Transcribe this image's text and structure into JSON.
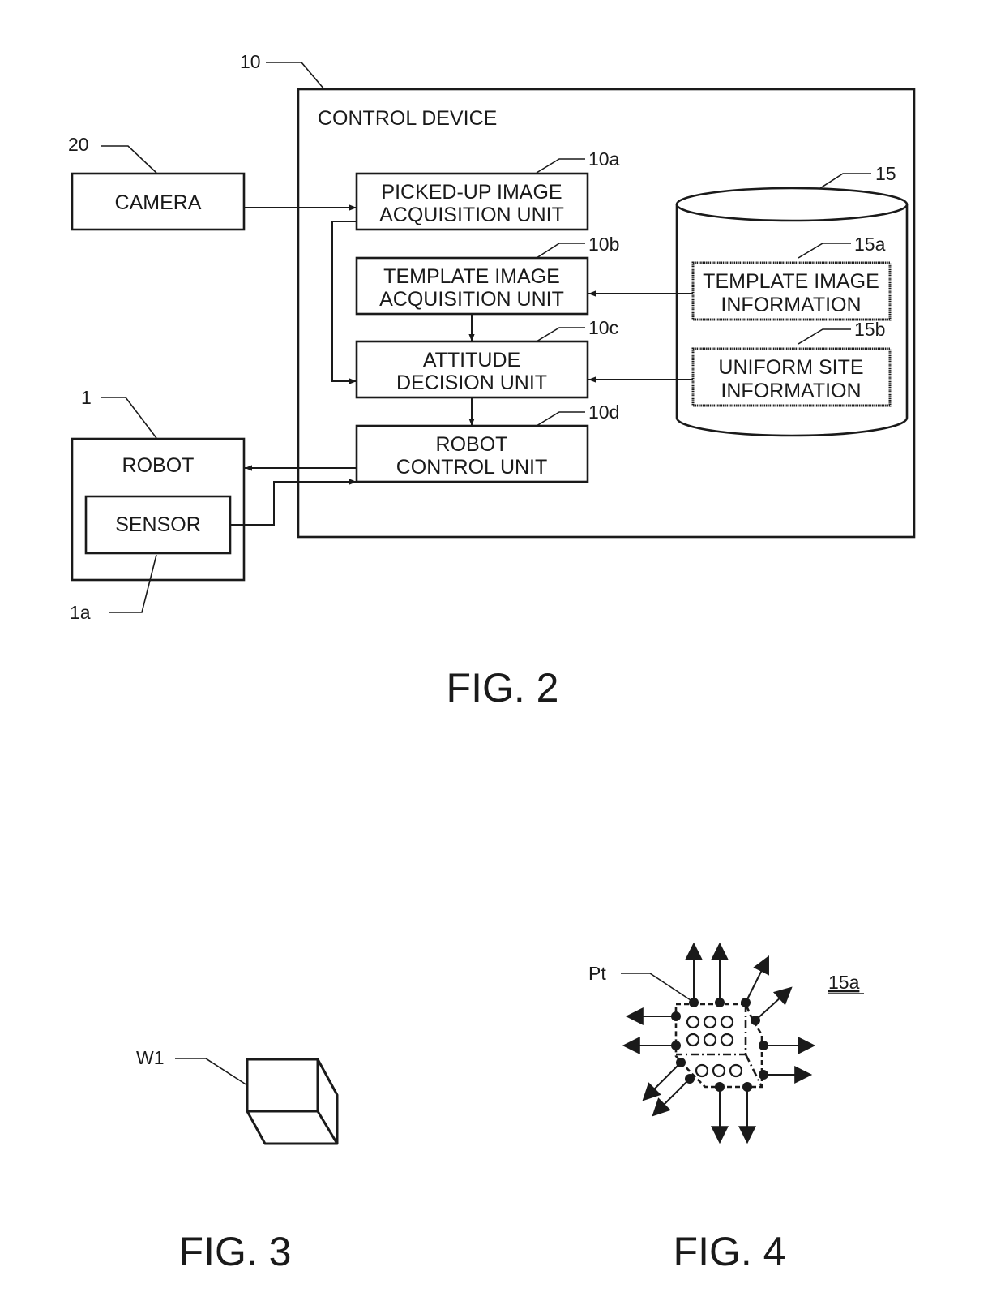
{
  "figures": {
    "fig2": {
      "caption": "FIG. 2",
      "control_device": {
        "ref": "10",
        "title": "CONTROL DEVICE",
        "units": [
          {
            "ref": "10a",
            "line1": "PICKED-UP IMAGE",
            "line2": "ACQUISITION UNIT"
          },
          {
            "ref": "10b",
            "line1": "TEMPLATE IMAGE",
            "line2": "ACQUISITION UNIT"
          },
          {
            "ref": "10c",
            "line1": "ATTITUDE",
            "line2": "DECISION UNIT"
          },
          {
            "ref": "10d",
            "line1": "ROBOT",
            "line2": "CONTROL UNIT"
          }
        ]
      },
      "camera": {
        "ref": "20",
        "label": "CAMERA"
      },
      "robot": {
        "ref": "1",
        "label": "ROBOT",
        "sensor": {
          "ref": "1a",
          "label": "SENSOR"
        }
      },
      "storage": {
        "ref": "15",
        "items": [
          {
            "ref": "15a",
            "line1": "TEMPLATE IMAGE",
            "line2": "INFORMATION"
          },
          {
            "ref": "15b",
            "line1": "UNIFORM SITE",
            "line2": "INFORMATION"
          }
        ]
      }
    },
    "fig3": {
      "caption": "FIG. 3",
      "workpiece_ref": "W1"
    },
    "fig4": {
      "caption": "FIG. 4",
      "point_ref": "Pt",
      "info_ref": "15a"
    }
  }
}
